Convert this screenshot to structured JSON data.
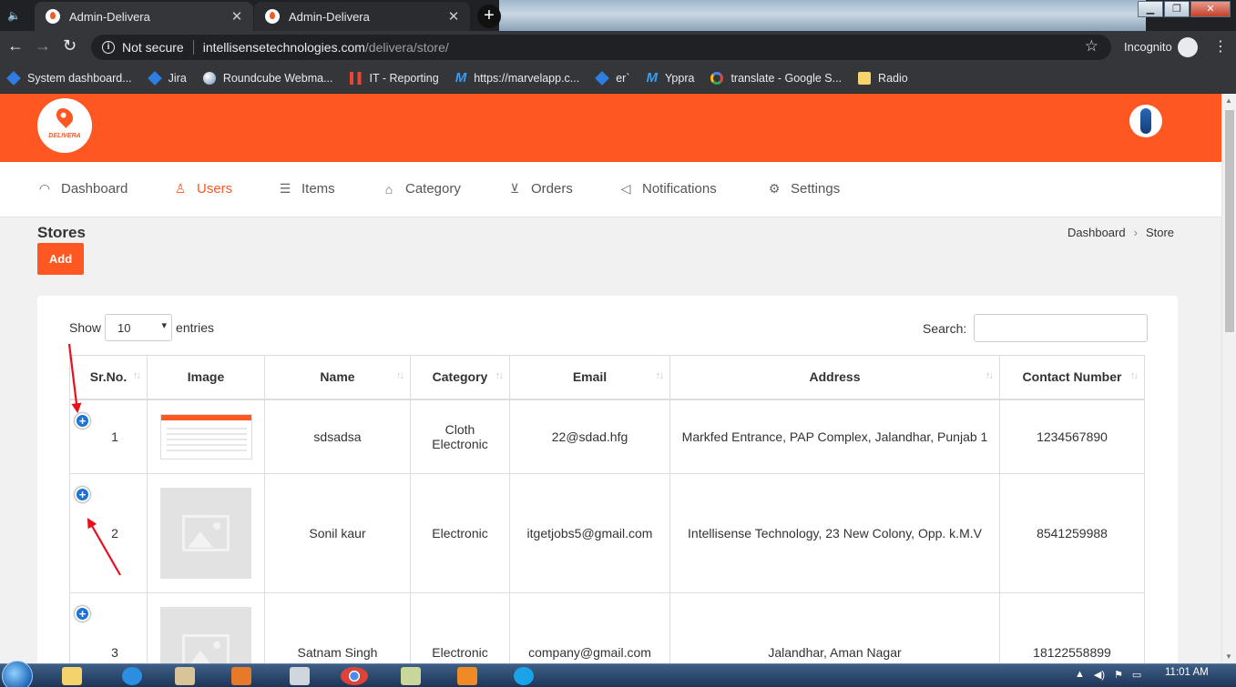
{
  "browser": {
    "tabs": [
      {
        "title": "Admin-Delivera"
      },
      {
        "title": "Admin-Delivera"
      }
    ],
    "security_label": "Not secure",
    "url_host": "intellisensetechnologies.com",
    "url_path": "/delivera/store/",
    "profile_label": "Incognito",
    "bookmarks": [
      {
        "label": "System dashboard...",
        "icon": "jira-diamond-icon"
      },
      {
        "label": "Jira",
        "icon": "jira-diamond-icon"
      },
      {
        "label": "Roundcube Webma...",
        "icon": "roundcube-icon"
      },
      {
        "label": "IT - Reporting",
        "icon": "reporting-bars-icon"
      },
      {
        "label": "https://marvelapp.c...",
        "icon": "marvel-icon"
      },
      {
        "label": "er`",
        "icon": "jira-diamond-icon"
      },
      {
        "label": "Yppra",
        "icon": "marvel-icon"
      },
      {
        "label": "translate - Google S...",
        "icon": "google-icon"
      },
      {
        "label": "Radio",
        "icon": "folder-icon"
      }
    ]
  },
  "app": {
    "brand": "DELIVERA",
    "accent_color": "#ff5722",
    "nav": [
      {
        "label": "Dashboard",
        "icon": "dashboard-gauge-icon"
      },
      {
        "label": "Users",
        "icon": "user-icon",
        "active": true
      },
      {
        "label": "Items",
        "icon": "list-icon"
      },
      {
        "label": "Category",
        "icon": "tag-icon"
      },
      {
        "label": "Orders",
        "icon": "cart-icon"
      },
      {
        "label": "Notifications",
        "icon": "megaphone-icon"
      },
      {
        "label": "Settings",
        "icon": "gear-icon"
      }
    ],
    "page_title": "Stores",
    "breadcrumb": [
      "Dashboard",
      "Store"
    ],
    "add_label": "Add"
  },
  "table": {
    "show_label": "Show",
    "page_length": "10",
    "entries_label": "entries",
    "search_label": "Search:",
    "search_value": "",
    "columns": [
      "Sr.No.",
      "Image",
      "Name",
      "Category",
      "Email",
      "Address",
      "Contact Number"
    ],
    "rows": [
      {
        "sr": "1",
        "image": "screenshot-thumbnail",
        "name": "sdsadsa",
        "category": [
          "Cloth",
          "Electronic"
        ],
        "email": "22@sdad.hfg",
        "address": "Markfed Entrance, PAP Complex, Jalandhar, Punjab 1",
        "contact": "1234567890"
      },
      {
        "sr": "2",
        "image": "placeholder-image",
        "name": "Sonil kaur",
        "category": [
          "Electronic"
        ],
        "email": "itgetjobs5@gmail.com",
        "address": "Intellisense Technology, 23 New Colony, Opp. k.M.V",
        "contact": "8541259988"
      },
      {
        "sr": "3",
        "image": "placeholder-image",
        "name": "Satnam Singh",
        "category": [
          "Electronic"
        ],
        "email": "company@gmail.com",
        "address": "Jalandhar, Aman Nagar",
        "contact": "18122558899"
      }
    ]
  },
  "taskbar": {
    "time": "11:01 AM"
  }
}
